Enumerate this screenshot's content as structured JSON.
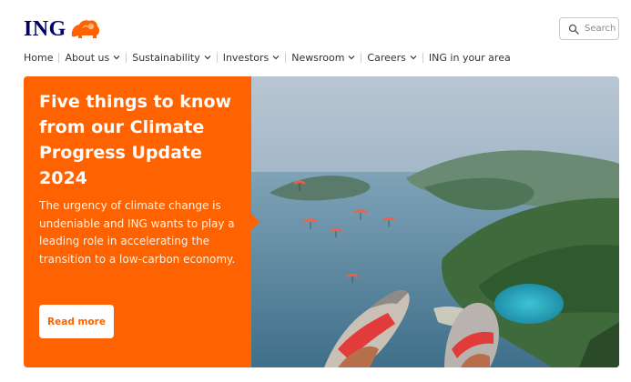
{
  "brand": {
    "logo_text": "ING",
    "accent": "#ff6200",
    "navy": "#000066"
  },
  "search": {
    "placeholder": "Search",
    "icon": "search-icon"
  },
  "nav": [
    {
      "label": "Home",
      "dropdown": false
    },
    {
      "label": "About us",
      "dropdown": true
    },
    {
      "label": "Sustainability",
      "dropdown": true
    },
    {
      "label": "Investors",
      "dropdown": true
    },
    {
      "label": "Newsroom",
      "dropdown": true
    },
    {
      "label": "Careers",
      "dropdown": true
    },
    {
      "label": "ING in your area",
      "dropdown": false
    }
  ],
  "hero": {
    "headline": "Five things to know from our Climate Progress Update 2024",
    "body": "The urgency of climate change is undeniable and ING wants to play a leading role in accelerating the transition to a low-carbon economy.",
    "cta_label": "Read more"
  }
}
